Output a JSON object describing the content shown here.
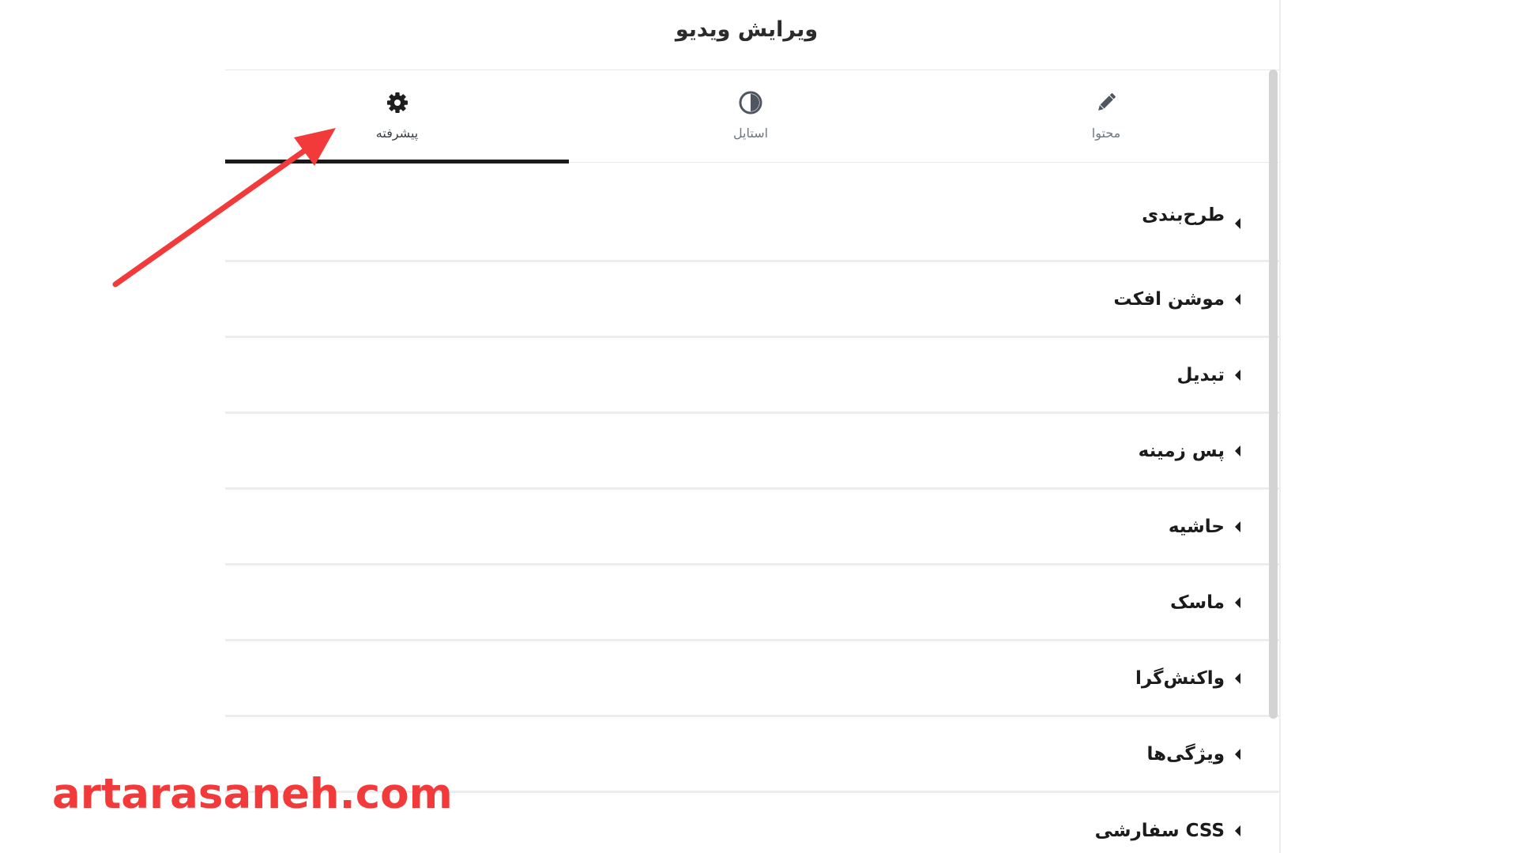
{
  "panel": {
    "title": "ویرایش ویدیو"
  },
  "tabs": [
    {
      "label": "پیشرفته",
      "icon": "gear-icon",
      "active": true
    },
    {
      "label": "استایل",
      "icon": "contrast-icon",
      "active": false
    },
    {
      "label": "محتوا",
      "icon": "pencil-icon",
      "active": false
    }
  ],
  "sections": [
    {
      "label": "طرح‌بندی"
    },
    {
      "label": "موشن افکت"
    },
    {
      "label": "تبدیل"
    },
    {
      "label": "پس زمینه"
    },
    {
      "label": "حاشیه"
    },
    {
      "label": "ماسک"
    },
    {
      "label": "واکنش‌گرا"
    },
    {
      "label": "ویژگی‌ها"
    },
    {
      "label": "CSS سفارشی"
    }
  ],
  "watermark": {
    "text": "artarasaneh.com"
  },
  "colors": {
    "accent_arrow": "#f23a3a",
    "active_tab_underline": "#1a1a1a",
    "divider": "#ededed",
    "icon_color": "#4f5660"
  }
}
